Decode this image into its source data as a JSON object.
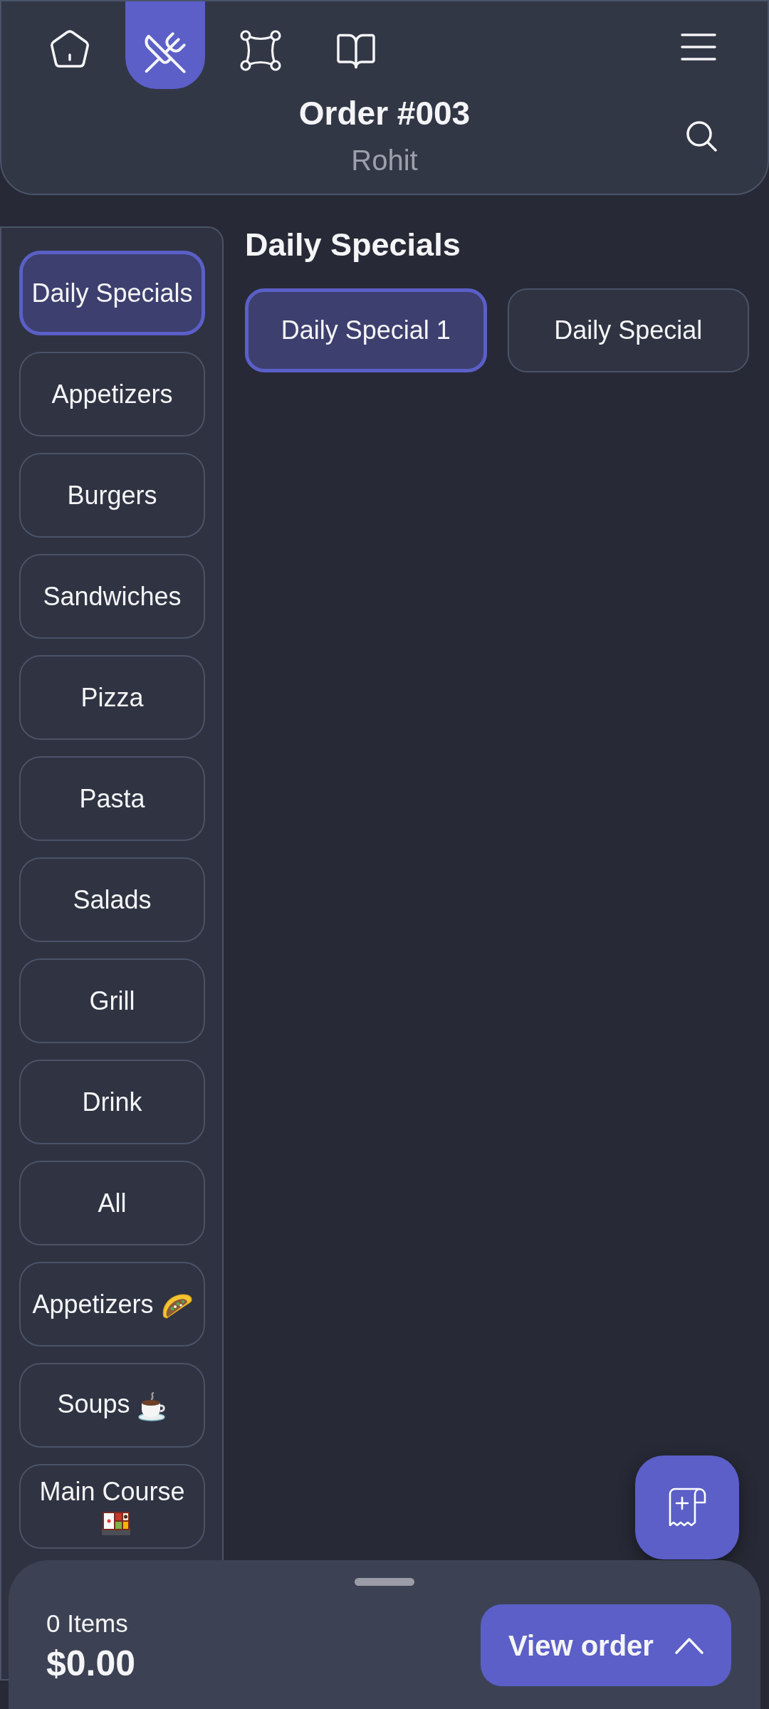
{
  "header": {
    "nav_tabs": [
      {
        "kind": "home",
        "selected": false
      },
      {
        "kind": "dining",
        "selected": true
      },
      {
        "kind": "network",
        "selected": false
      },
      {
        "kind": "book",
        "selected": false
      }
    ],
    "title": "Order #003",
    "subtitle": "Rohit"
  },
  "categories": [
    {
      "label": "Daily Specials",
      "kind": "plain",
      "selected": true
    },
    {
      "label": "Appetizers",
      "kind": "plain",
      "selected": false
    },
    {
      "label": "Burgers",
      "kind": "plain",
      "selected": false
    },
    {
      "label": "Sandwiches",
      "kind": "plain",
      "selected": false
    },
    {
      "label": "Pizza",
      "kind": "plain",
      "selected": false
    },
    {
      "label": "Pasta",
      "kind": "plain",
      "selected": false
    },
    {
      "label": "Salads",
      "kind": "plain",
      "selected": false
    },
    {
      "label": "Grill",
      "kind": "plain",
      "selected": false
    },
    {
      "label": "Drink",
      "kind": "plain",
      "selected": false
    },
    {
      "label": "All",
      "kind": "plain",
      "selected": false
    },
    {
      "label": "Appetizers",
      "kind": "taco",
      "selected": false
    },
    {
      "label": "Soups",
      "kind": "coffee",
      "selected": false
    },
    {
      "label": "Main Course",
      "kind": "bento",
      "selected": false
    }
  ],
  "section": {
    "title": "Daily Specials",
    "items": [
      {
        "label": "Daily Special 1",
        "selected": true
      },
      {
        "label": "Daily Special",
        "selected": false
      }
    ]
  },
  "order_summary": {
    "count": "0 Items",
    "total": "$0.00",
    "button": "View order"
  }
}
